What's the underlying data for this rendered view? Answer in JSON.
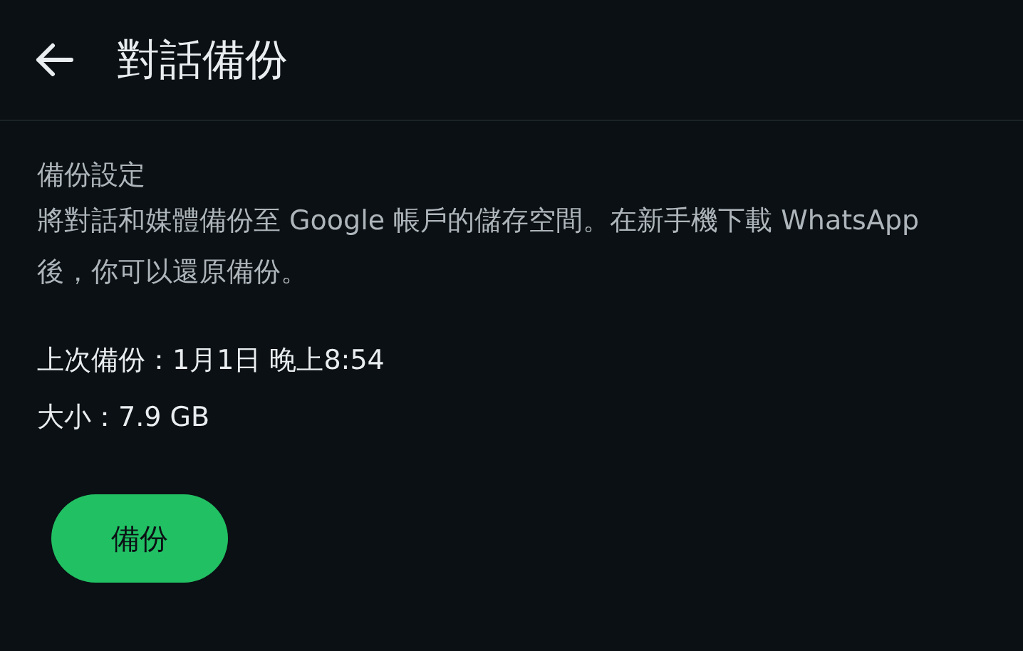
{
  "header": {
    "title": "對話備份"
  },
  "settings": {
    "heading": "備份設定",
    "description": "將對話和媒體備份至 Google 帳戶的儲存空間。在新手機下載 WhatsApp 後，你可以還原備份。"
  },
  "info": [
    "上次備份：1月1日 晚上8:54",
    "大小：7.9 GB"
  ],
  "button": {
    "label": "備份"
  }
}
